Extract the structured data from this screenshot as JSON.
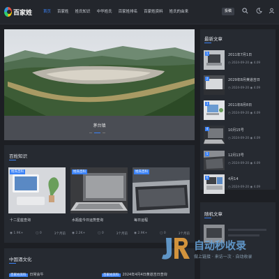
{
  "header": {
    "logo_text": "百家姓",
    "nav": [
      "首页",
      "百家姓",
      "姓氏知识",
      "中华姓氏",
      "百家姓排名",
      "百家姓资料",
      "姓氏的由来"
    ],
    "action_button": "投稿"
  },
  "hero": {
    "caption": "茅台镇"
  },
  "knowledge": {
    "title": "百姓知识",
    "cards": [
      {
        "tag": "姓氏百科",
        "title": "十二星座查询",
        "views": "1.9K+",
        "comments": "0",
        "likes": "3个月前"
      },
      {
        "tag": "姓氏百科",
        "title": "水瓶座今日运势查询",
        "views": "2.2K+",
        "comments": "0",
        "likes": "3个月前"
      },
      {
        "tag": "姓氏百科",
        "title": "每日运程",
        "views": "2.9K+",
        "comments": "0",
        "likes": "3个月前"
      }
    ]
  },
  "culture": {
    "title": "中国酒文化",
    "items": [
      {
        "tag": "百家姓资料",
        "title": "日常会牛"
      },
      {
        "tag": "百家姓资料",
        "title": "2024年4月4日黄道吉日查询"
      }
    ]
  },
  "latest": {
    "title": "最新文章",
    "items": [
      {
        "num": "1",
        "title": "2011年7月1日",
        "date": "2024-09-20",
        "views": "4.09"
      },
      {
        "num": "2",
        "title": "2029年8月黄道吉日",
        "date": "2024-09-20",
        "views": "4.09"
      },
      {
        "num": "3",
        "title": "2011年8月8日",
        "date": "2024-09-20",
        "views": "4.09"
      },
      {
        "num": "4",
        "title": "10月15号",
        "date": "2024-09-20",
        "views": "4.09"
      },
      {
        "num": "5",
        "title": "12月13号",
        "date": "2024-09-20",
        "views": "4.09"
      },
      {
        "num": "6",
        "title": "4月14",
        "date": "2024-09-20",
        "views": "4.09"
      }
    ]
  },
  "random": {
    "title": "随机文章"
  },
  "watermark": {
    "text": "自动秒收录",
    "sub": "做上链接 · 来访一次 · 自动收录"
  }
}
